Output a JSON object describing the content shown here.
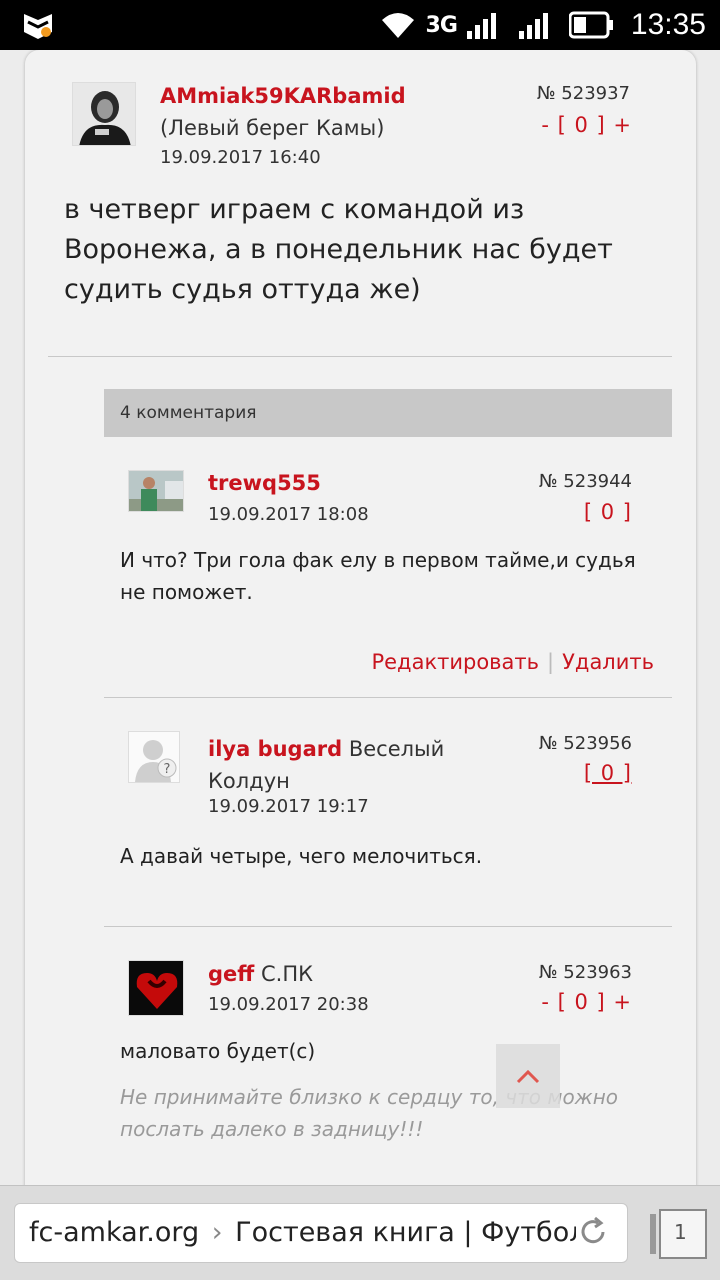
{
  "status_bar": {
    "network": "3G",
    "time": "13:35"
  },
  "post": {
    "author": "AMmiak59KARbamid",
    "location": "(Левый берег Камы)",
    "date": "19.09.2017 16:40",
    "number": "№ 523937",
    "votes": "- [ 0 ] +",
    "text": "в четверг играем с командой из Воронежа, а в понедельник нас будет судить судья оттуда же)"
  },
  "comments_header": "4 комментария",
  "comments": [
    {
      "author": "trewq555",
      "title": "",
      "date": "19.09.2017 18:08",
      "number": "№ 523944",
      "votes": "[ 0 ]",
      "text": "И что? Три гола фак елу в первом тайме,и судья не поможет.",
      "edit_label": "Редактировать",
      "delete_label": "Удалить"
    },
    {
      "author": "ilya bugard",
      "title": "Веселый Колдун",
      "date": "19.09.2017 19:17",
      "number": "№ 523956",
      "votes": "[ 0 ]",
      "text": "А давай четыре, чего мелочиться."
    },
    {
      "author": "geff",
      "title": "С.ПК",
      "date": "19.09.2017 20:38",
      "number": "№ 523963",
      "votes": "- [ 0 ] +",
      "text": "маловато будет(с)",
      "signature": "Не принимайте близко к сердцу то, что можно послать далеко в задницу!!!"
    }
  ],
  "browser": {
    "domain": "fc-amkar.org",
    "separator": "›",
    "page_title": "Гостевая книга | Футбол",
    "tab_count": "1"
  },
  "colors": {
    "accent": "#c8141e",
    "bar": "#c8c8c8",
    "card": "#f2f2f2"
  }
}
